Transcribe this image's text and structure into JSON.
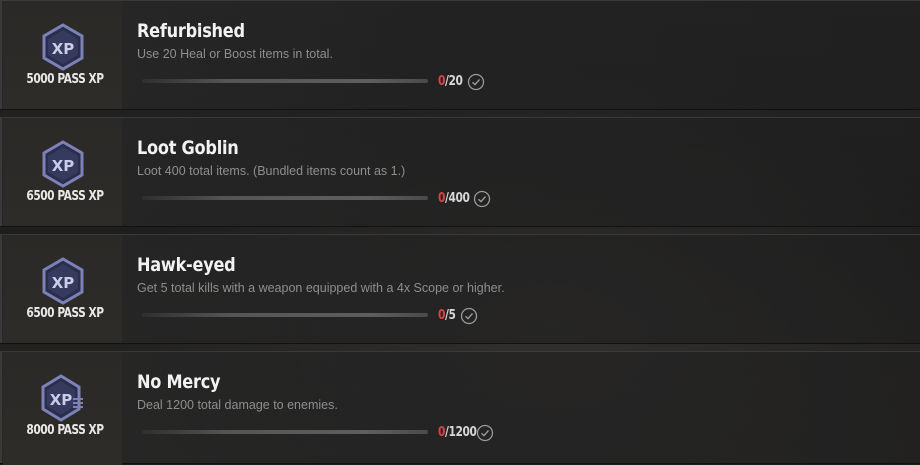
{
  "colors": {
    "accent_red": "#d84545",
    "badge_fill": "#2b2e4a",
    "badge_border": "#7c82b8"
  },
  "missions": [
    {
      "reward_icon": "xp-badge-icon",
      "reward": "5000 PASS XP",
      "title": "Refurbished",
      "description": "Use 20 Heal or Boost items in total.",
      "current": "0",
      "total": "/20",
      "progress_fraction": 0,
      "status_icon": "check-circle-icon"
    },
    {
      "reward_icon": "xp-badge-icon",
      "reward": "6500 PASS XP",
      "title": "Loot Goblin",
      "description": "Loot 400 total items. (Bundled items count as 1.)",
      "current": "0",
      "total": "/400",
      "progress_fraction": 0,
      "status_icon": "check-circle-icon"
    },
    {
      "reward_icon": "xp-badge-icon",
      "reward": "6500 PASS XP",
      "title": "Hawk-eyed",
      "description": "Get 5 total kills with a weapon equipped with a 4x Scope or higher.",
      "current": "0",
      "total": "/5",
      "progress_fraction": 0,
      "status_icon": "check-circle-icon"
    },
    {
      "reward_icon": "xp-badge-boosted-icon",
      "reward": "8000 PASS XP",
      "title": "No Mercy",
      "description": "Deal 1200 total damage to enemies.",
      "current": "0",
      "total": "/1200",
      "progress_fraction": 0,
      "status_icon": "check-circle-icon"
    }
  ]
}
